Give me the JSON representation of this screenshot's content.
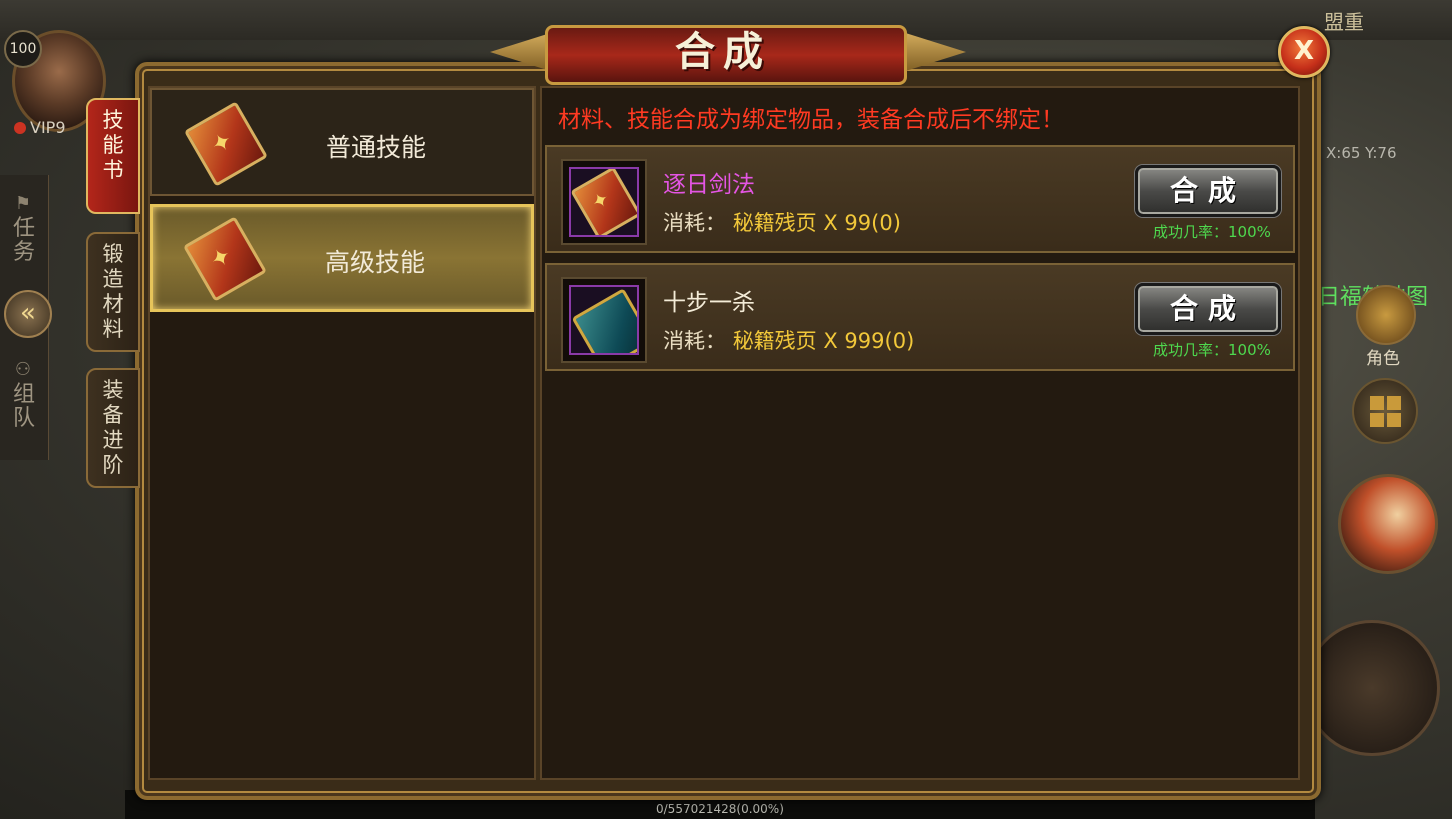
{
  "hud": {
    "level": "100",
    "vip": "VIP9",
    "top_right_label": "盟重",
    "coords": "X:65 Y:76",
    "side_task": "任务",
    "side_team": "组队",
    "right_char": "角色",
    "map_banner": "日福鹤地图",
    "exp": "0/557021428(0.00%)"
  },
  "dialog": {
    "title": "合成",
    "close_label": "X",
    "tabs": [
      {
        "label": "技能书",
        "active": true
      },
      {
        "label": "锻造材料",
        "active": false
      },
      {
        "label": "装备进阶",
        "active": false
      }
    ],
    "categories": [
      {
        "label": "普通技能",
        "active": false
      },
      {
        "label": "高级技能",
        "active": true
      }
    ],
    "notice": "材料、技能合成为绑定物品，装备合成后不绑定！",
    "recipes": [
      {
        "name": "逐日剑法",
        "name_color": "#e455e4",
        "cost_label": "消耗：",
        "material": "秘籍残页",
        "quantity": "X 99(0)",
        "button": "合成",
        "rate": "成功几率：100%"
      },
      {
        "name": "十步一杀",
        "name_color": "#f4ecd8",
        "cost_label": "消耗：",
        "material": "秘籍残页",
        "quantity": "X 999(0)",
        "button": "合成",
        "rate": "成功几率：100%"
      }
    ]
  }
}
